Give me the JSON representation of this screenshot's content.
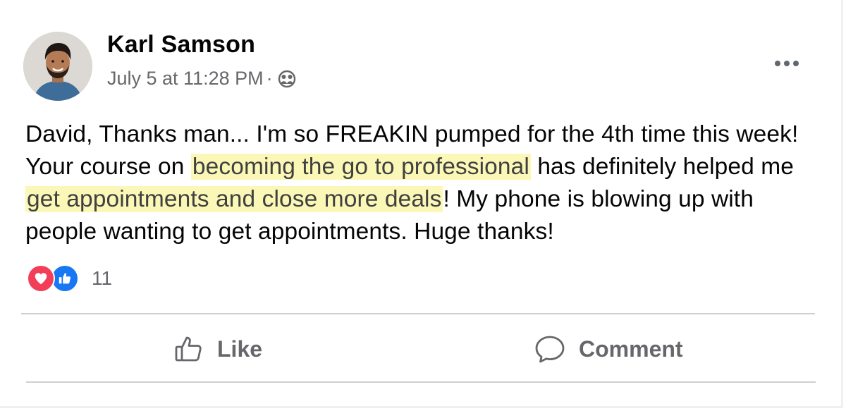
{
  "post": {
    "author": {
      "name": "Karl Samson"
    },
    "timestamp": "July 5 at 11:28 PM",
    "separator": "·",
    "audience_icon": "friends-icon",
    "more_icon": "more-options-icon",
    "text": {
      "seg1": "David, Thanks man... I'm so FREAKIN pumped for the 4th time this week! Your course on ",
      "hl1": "becoming the go to professional",
      "seg2": " has definitely helped me ",
      "hl2": "get appointments and close more deals",
      "seg3": "! My phone is blowing up with people wanting to get appointments. Huge thanks!"
    },
    "highlight_color": "#fbf8b7",
    "reactions": {
      "icons": [
        "love-icon",
        "like-icon"
      ],
      "count": "11"
    },
    "actions": {
      "like_label": "Like",
      "comment_label": "Comment"
    }
  },
  "colors": {
    "primary_text": "#050505",
    "secondary_text": "#65676b",
    "divider": "#ced0d4",
    "love": "#f33e58",
    "like": "#1877f2"
  }
}
